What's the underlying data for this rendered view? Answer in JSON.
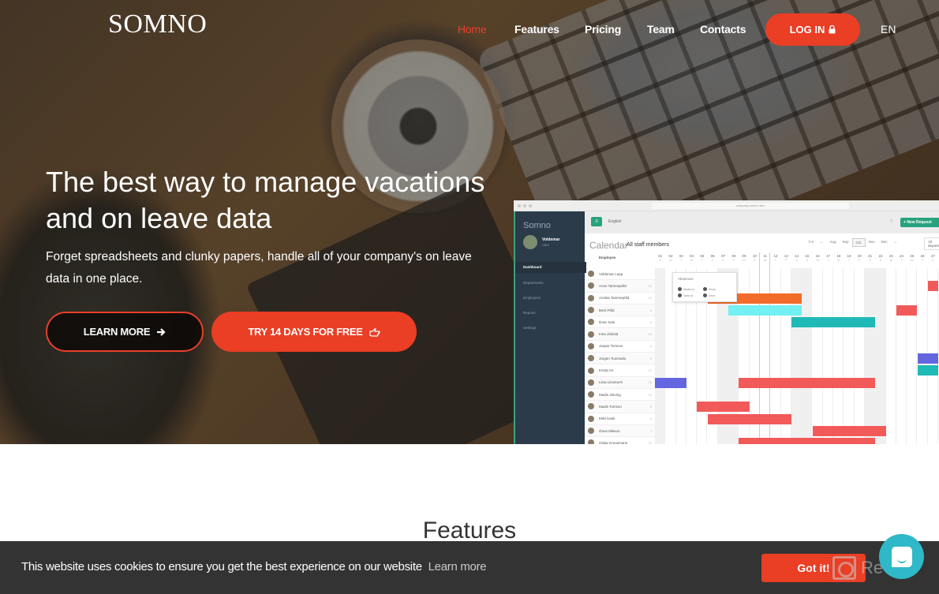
{
  "nav": {
    "logo": "SOMNO",
    "links": [
      {
        "label": "Home",
        "active": true
      },
      {
        "label": "Features",
        "active": false
      },
      {
        "label": "Pricing",
        "active": false
      },
      {
        "label": "Team",
        "active": false
      },
      {
        "label": "Contacts",
        "active": false
      }
    ],
    "login_label": "LOG IN",
    "login_icon": "lock-icon",
    "language": "EN"
  },
  "hero": {
    "title": "The best way to manage vacations and on leave data",
    "subtitle": "Forget spreadsheets and clunky papers, handle all of your company's on leave data in one place.",
    "learn_more_label": "LEARN MORE",
    "learn_more_icon": "arrow-right-icon",
    "try_label": "TRY 14 DAYS FOR FREE",
    "try_icon": "hand-pointing-icon"
  },
  "mockup": {
    "url": "company.somno.dev",
    "brand": "Somno",
    "user_name": "Voldemar",
    "user_role": "CEO",
    "sidebar": [
      {
        "label": "Dashboard",
        "active": true
      },
      {
        "label": "Departments",
        "active": false
      },
      {
        "label": "Employees",
        "active": false
      },
      {
        "label": "Reports",
        "active": false
      },
      {
        "label": "Settings",
        "active": false
      }
    ],
    "language_select": "English",
    "new_request_label": "+ New Request",
    "calendar_title": "Calendar",
    "calendar_subtitle": "All staff members",
    "months": [
      "Aug",
      "Sep",
      "Oct",
      "Nov",
      "Dec"
    ],
    "selected_month": "Oct",
    "department_filter": "All departments",
    "employee_header": "Employee",
    "days": [
      "01",
      "02",
      "03",
      "04",
      "05",
      "06",
      "07",
      "08",
      "09",
      "10",
      "11",
      "12",
      "13",
      "14",
      "15",
      "16",
      "17",
      "18",
      "19",
      "20",
      "21",
      "22",
      "23",
      "24",
      "25",
      "26",
      "27"
    ],
    "weekdays": [
      "S",
      "M",
      "T",
      "W",
      "T",
      "F",
      "S",
      "S",
      "M",
      "T",
      "W",
      "T",
      "F",
      "S",
      "S",
      "M",
      "T",
      "W",
      "T",
      "F",
      "S",
      "S",
      "M",
      "T",
      "W",
      "T",
      "F"
    ],
    "employees": [
      {
        "name": "Voldemar Lepp",
        "count": ""
      },
      {
        "name": "Anne Tammepõld",
        "count": "15"
      },
      {
        "name": "Annika Tammepõld",
        "count": "20"
      },
      {
        "name": "Berit Põld",
        "count": "6"
      },
      {
        "name": "Ilmar Salu",
        "count": "6"
      },
      {
        "name": "Irina Jõelaid",
        "count": "15"
      },
      {
        "name": "Jaspar Tomson",
        "count": "5"
      },
      {
        "name": "Jürgen Toomsalu",
        "count": "6"
      },
      {
        "name": "Krista Art",
        "count": "12"
      },
      {
        "name": "Liina Liivanurm",
        "count": "15"
      },
      {
        "name": "Madis Järving",
        "count": "13"
      },
      {
        "name": "Madis Tomson",
        "count": "5"
      },
      {
        "name": "Milvi Kask",
        "count": "6"
      },
      {
        "name": "Õnne Mikson",
        "count": "7"
      },
      {
        "name": "Oskar Kruusmann",
        "count": "12"
      }
    ],
    "absences_popup": {
      "title": "Absences",
      "items": [
        "Madis on",
        "Krista",
        "Taavi at",
        "Dave"
      ]
    },
    "colors": {
      "orange": "#f26b2a",
      "cyan": "#72f0f2",
      "teal": "#1fbab6",
      "red": "#f25a5a",
      "purple": "#6466e0"
    },
    "leaves": [
      {
        "row": 1,
        "start": 27,
        "end": 27,
        "color": "red"
      },
      {
        "row": 2,
        "start": 6,
        "end": 14,
        "color": "orange"
      },
      {
        "row": 3,
        "start": 8,
        "end": 14,
        "color": "cyan"
      },
      {
        "row": 3,
        "start": 24,
        "end": 25,
        "color": "red"
      },
      {
        "row": 4,
        "start": 14,
        "end": 21,
        "color": "teal"
      },
      {
        "row": 7,
        "start": 26,
        "end": 27,
        "color": "purple"
      },
      {
        "row": 8,
        "start": 26,
        "end": 27,
        "color": "teal"
      },
      {
        "row": 9,
        "start": 1,
        "end": 3,
        "color": "purple"
      },
      {
        "row": 9,
        "start": 9,
        "end": 21,
        "color": "red"
      },
      {
        "row": 11,
        "start": 5,
        "end": 9,
        "color": "red"
      },
      {
        "row": 12,
        "start": 6,
        "end": 13,
        "color": "red"
      },
      {
        "row": 13,
        "start": 16,
        "end": 22,
        "color": "red"
      },
      {
        "row": 14,
        "start": 9,
        "end": 21,
        "color": "red"
      }
    ]
  },
  "features": {
    "title": "Features"
  },
  "cookie": {
    "message": "This website uses cookies to ensure you get the best experience on our website",
    "learn_more": "Learn more",
    "accept_label": "Got it!"
  },
  "watermark": "Revain",
  "chat_icon": "chat-bubble-icon",
  "accent_color": "#ea3e25"
}
